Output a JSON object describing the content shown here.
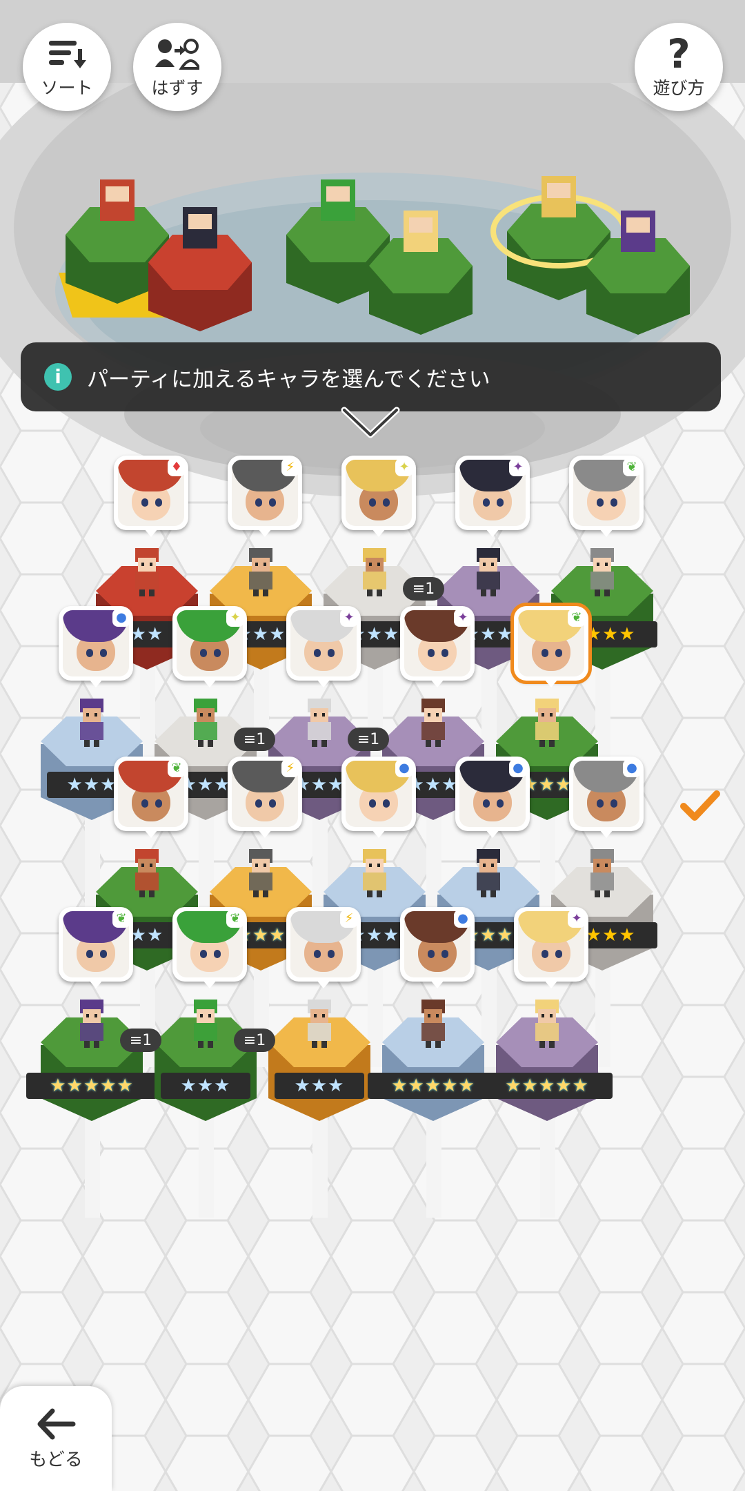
{
  "toolbar": {
    "sort_label": "ソート",
    "remove_label": "はずす",
    "help_label": "遊び方",
    "help_glyph": "?"
  },
  "banner": {
    "info_glyph": "i",
    "text": "パーティに加えるキャラを選んでください"
  },
  "back": {
    "label": "もどる"
  },
  "colors": {
    "selected_outline": "#f08a1d",
    "banner_bg": "#232323",
    "info_icon": "#3fc2b0"
  },
  "party_slots": [
    {
      "pedestal": "green"
    },
    {
      "pedestal": "red"
    },
    {
      "pedestal": "green"
    },
    {
      "pedestal": "green"
    },
    {
      "pedestal": "green",
      "active": true
    },
    {
      "pedestal": "green"
    }
  ],
  "roster": [
    {
      "row": 0,
      "col": 0,
      "element": "fire",
      "stars": "★★",
      "stars_count": 2,
      "pedestal": "red",
      "dup": "",
      "partial": true
    },
    {
      "row": 0,
      "col": 1,
      "element": "thunder",
      "stars": "★★★",
      "stars_count": 3,
      "pedestal": "yellow",
      "dup": ""
    },
    {
      "row": 0,
      "col": 2,
      "element": "light",
      "stars": "★★★",
      "stars_count": 3,
      "pedestal": "white",
      "dup": ""
    },
    {
      "row": 0,
      "col": 3,
      "element": "dark",
      "stars": "★★★",
      "stars_count": 3,
      "pedestal": "purple",
      "dup": "1"
    },
    {
      "row": 0,
      "col": 4,
      "element": "wind",
      "stars": "★★★★",
      "stars_count": 4,
      "pedestal": "green",
      "dup": ""
    },
    {
      "row": 1,
      "col": 0,
      "element": "water",
      "stars": "★★★",
      "stars_count": 3,
      "pedestal": "blue",
      "dup": ""
    },
    {
      "row": 1,
      "col": 1,
      "element": "light",
      "stars": "★★★",
      "stars_count": 3,
      "pedestal": "white",
      "dup": ""
    },
    {
      "row": 1,
      "col": 2,
      "element": "dark",
      "stars": "★★★",
      "stars_count": 3,
      "pedestal": "purple",
      "dup": "1"
    },
    {
      "row": 1,
      "col": 3,
      "element": "dark",
      "stars": "★★★",
      "stars_count": 3,
      "pedestal": "purple",
      "dup": "1"
    },
    {
      "row": 1,
      "col": 4,
      "element": "wind",
      "stars": "★★★★★",
      "stars_count": 5,
      "pedestal": "green",
      "dup": "",
      "selected": true
    },
    {
      "row": 2,
      "col": 0,
      "element": "wind",
      "stars": "★★",
      "stars_count": 2,
      "pedestal": "green",
      "dup": "",
      "partial": true
    },
    {
      "row": 2,
      "col": 1,
      "element": "thunder",
      "stars": "★★★★★",
      "stars_count": 5,
      "pedestal": "yellow",
      "dup": ""
    },
    {
      "row": 2,
      "col": 2,
      "element": "water",
      "stars": "★★★",
      "stars_count": 3,
      "pedestal": "blue",
      "dup": ""
    },
    {
      "row": 2,
      "col": 3,
      "element": "water",
      "stars": "★★★★★",
      "stars_count": 5,
      "pedestal": "blue",
      "dup": ""
    },
    {
      "row": 2,
      "col": 4,
      "element": "water",
      "stars": "★★★★",
      "stars_count": 4,
      "pedestal": "white",
      "dup": ""
    },
    {
      "row": 3,
      "col": 0,
      "element": "wind",
      "stars": "★★★★★",
      "stars_count": 5,
      "pedestal": "green",
      "dup": ""
    },
    {
      "row": 3,
      "col": 1,
      "element": "wind",
      "stars": "★★★",
      "stars_count": 3,
      "pedestal": "green",
      "dup": "1"
    },
    {
      "row": 3,
      "col": 2,
      "element": "thunder",
      "stars": "★★★",
      "stars_count": 3,
      "pedestal": "yellow",
      "dup": "1"
    },
    {
      "row": 3,
      "col": 3,
      "element": "water",
      "stars": "★★★★★",
      "stars_count": 5,
      "pedestal": "blue",
      "dup": ""
    },
    {
      "row": 3,
      "col": 4,
      "element": "dark",
      "stars": "★★★★★",
      "stars_count": 5,
      "pedestal": "purple",
      "dup": ""
    }
  ]
}
